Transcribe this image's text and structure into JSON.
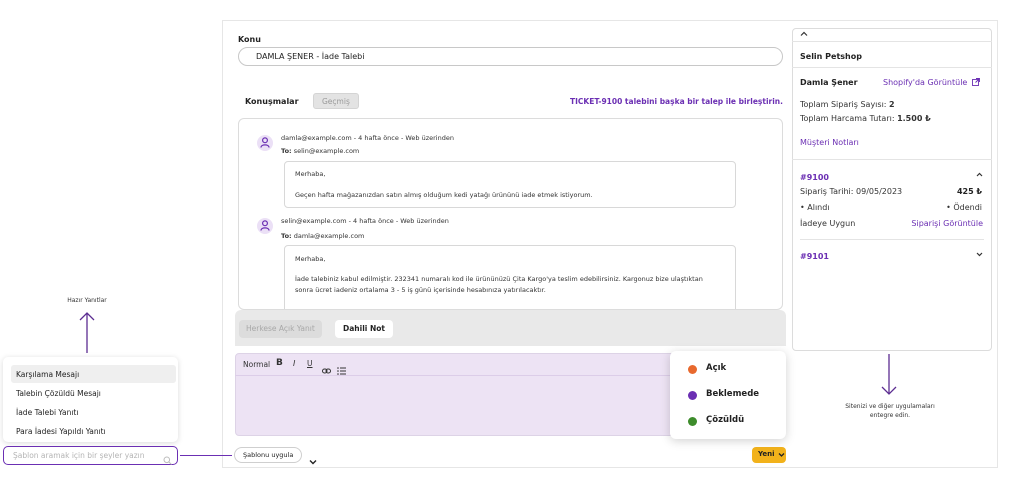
{
  "ticket": {
    "subject_label": "Konu",
    "subject_value": "DAMLA ŞENER - İade Talebi",
    "tab_conversations": "Konuşmalar",
    "tab_history": "Geçmiş",
    "merge_notice": "TICKET-9100 talebini başka bir talep ile birleştirin."
  },
  "thread": [
    {
      "meta": "damla@example.com  -  4 hafta önce  -  Web üzerinden",
      "to_label": "To:",
      "to_value": "selin@example.com",
      "lines": [
        "Merhaba,",
        "Geçen hafta mağazanızdan satın almış olduğum kedi yatağı ürününü iade etmek istiyorum."
      ]
    },
    {
      "meta": "selin@example.com  -  4 hafta önce  -  Web üzerinden",
      "to_label": "To:",
      "to_value": "damla@example.com",
      "lines": [
        "Merhaba,",
        "İade talebiniz kabul edilmiştir. 232341 numaralı kod ile ürününüzü Çita Kargo'ya teslim edebilirsiniz. Kargonuz bize ulaştıktan",
        "sonra ücret iadeniz ortalama 3 - 5 iş günü içerisinde hesabınıza yatırılacaktır."
      ]
    }
  ],
  "compose": {
    "tab_public_reply": "Herkese Açık Yanıt",
    "tab_internal_note": "Dahili Not",
    "format_normal": "Normal",
    "bold": "B",
    "italic": "I",
    "underline": "U",
    "template_apply": "Şablonu uygula",
    "new_button": "Yeni"
  },
  "status_menu": [
    {
      "label": "Açık",
      "color": "#e8692e"
    },
    {
      "label": "Beklemede",
      "color": "#6b2fb3"
    },
    {
      "label": "Çözüldü",
      "color": "#3d8c2b"
    }
  ],
  "customer_panel": {
    "shop_name": "Selin Petshop",
    "customer_name": "Damla Şener",
    "shopify_link": "Shopify'da Görüntüle",
    "order_count_label": "Toplam Sipariş Sayısı:",
    "order_count_value": "2",
    "total_spend_label": "Toplam Harcama Tutarı:",
    "total_spend_value": "1.500 ₺",
    "customer_notes": "Müşteri Notları",
    "orders": [
      {
        "number": "#9100",
        "date": "Sipariş Tarihi: 09/05/2023",
        "amount": "425 ₺",
        "fulfillment": "• Alındı",
        "payment": "• Ödendi",
        "return_status": "İadeye Uygun",
        "view_link": "Siparişi Görüntüle"
      },
      {
        "number": "#9101"
      }
    ]
  },
  "annotations": {
    "integration_line1": "Sitenizi ve diğer uygulamaları",
    "integration_line2": "entegre edin.",
    "quick_replies": "Hazır Yanıtlar"
  },
  "templates": {
    "items": [
      "Karşılama Mesajı",
      "Talebin Çözüldü Mesajı",
      "İade Talebi Yanıtı",
      "Para İadesi Yapıldı Yanıtı"
    ],
    "search_placeholder": "Şablon aramak için bir şeyler yazın"
  },
  "colors": {
    "accent": "#6b2fb3",
    "new_button": "#f2b21b",
    "editor_bg": "#ede3f4"
  }
}
